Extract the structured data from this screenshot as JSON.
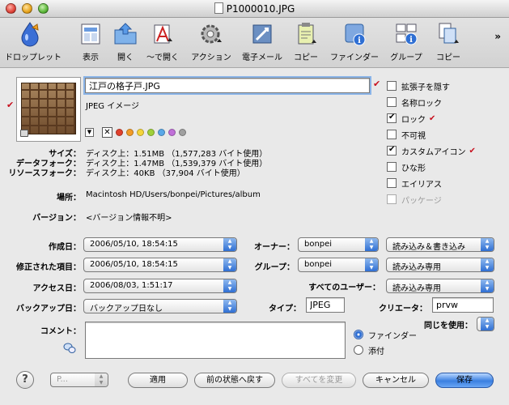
{
  "window": {
    "title": "P1000010.JPG"
  },
  "toolbar": {
    "items": [
      {
        "label": "ドロップレット",
        "icon": "droplet-icon"
      },
      {
        "label": "表示",
        "icon": "view-icon"
      },
      {
        "label": "開く",
        "icon": "open-folder-icon"
      },
      {
        "label": "〜で開く",
        "icon": "open-with-icon"
      },
      {
        "label": "アクション",
        "icon": "gear-icon"
      },
      {
        "label": "電子メール",
        "icon": "mail-icon"
      },
      {
        "label": "コピー",
        "icon": "clipboard-icon"
      },
      {
        "label": "ファインダー",
        "icon": "finder-icon"
      },
      {
        "label": "グループ",
        "icon": "group-icon"
      },
      {
        "label": "コピー",
        "icon": "copy-icon"
      }
    ],
    "overflow": "»"
  },
  "file": {
    "name": "江戸の格子戸.JPG",
    "kind": "JPEG イメージ",
    "size_label": "サイズ：",
    "size_value": "ディスク上：1.51MB （1,577,283 バイト使用）",
    "data_fork_label": "データフォーク：",
    "data_fork_value": "ディスク上：1.47MB （1,539,379 バイト使用）",
    "resource_fork_label": "リソースフォーク：",
    "resource_fork_value": "ディスク上：40KB （37,904 バイト使用）",
    "location_label": "場所：",
    "location_value": "Macintosh HD/Users/bonpei/Pictures/album",
    "version_label": "バージョン：",
    "version_value": "<バージョン情報不明>"
  },
  "label_colors": {
    "none": "✕",
    "colors": [
      "#e0402c",
      "#f29b26",
      "#f4d43a",
      "#9fd03a",
      "#5aa8e8",
      "#c070d8",
      "#a0a0a0"
    ]
  },
  "options": [
    {
      "label": "拡張子を隠す",
      "checked": false,
      "mark": false,
      "disabled": false
    },
    {
      "label": "名称ロック",
      "checked": false,
      "mark": false,
      "disabled": false
    },
    {
      "label": "ロック",
      "checked": true,
      "mark": true,
      "disabled": false
    },
    {
      "label": "不可視",
      "checked": false,
      "mark": false,
      "disabled": false
    },
    {
      "label": "カスタムアイコン",
      "checked": true,
      "mark": true,
      "disabled": false
    },
    {
      "label": "ひな形",
      "checked": false,
      "mark": false,
      "disabled": false
    },
    {
      "label": "エイリアス",
      "checked": false,
      "mark": false,
      "disabled": false
    },
    {
      "label": "パッケージ",
      "checked": false,
      "mark": false,
      "disabled": true
    }
  ],
  "check_mark": "✔",
  "dates": {
    "created_label": "作成日：",
    "created_value": "2006/05/10, 18:54:15",
    "modified_label": "修正された項目：",
    "modified_value": "2006/05/10, 18:54:15",
    "accessed_label": "アクセス日：",
    "accessed_value": "2006/08/03, 1:51:17",
    "backup_label": "バックアップ日：",
    "backup_value": "バックアップ日なし"
  },
  "permissions": {
    "owner_label": "オーナー：",
    "owner_value": "bonpei",
    "owner_perm": "読み込み＆書き込み",
    "group_label": "グループ：",
    "group_value": "bonpei",
    "group_perm": "読み込み専用",
    "everyone_label": "すべてのユーザー：",
    "everyone_perm": "読み込み専用"
  },
  "type_creator": {
    "type_label": "タイプ：",
    "type_value": "JPEG",
    "creator_label": "クリエータ：",
    "creator_value": "prvw"
  },
  "comment": {
    "label": "コメント：",
    "value": ""
  },
  "use_same": {
    "label": "同じを使用：",
    "options": [
      "ファインダー",
      "添付"
    ],
    "selected": 0
  },
  "buttons": {
    "help": "?",
    "preset": "P...",
    "apply": "適用",
    "revert": "前の状態へ戻す",
    "change_all": "すべてを変更",
    "cancel": "キャンセル",
    "save": "保存"
  }
}
